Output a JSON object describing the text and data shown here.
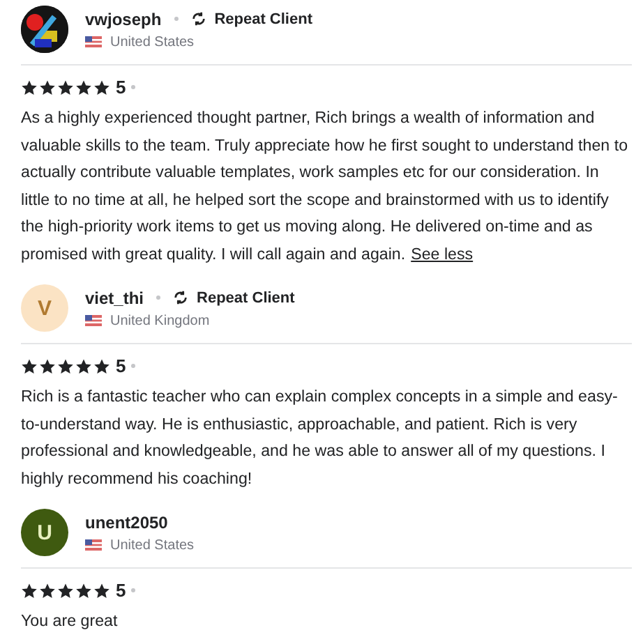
{
  "reviews": [
    {
      "name": "vwjoseph",
      "repeat_client": "Repeat Client",
      "country": "United States",
      "stars": 5,
      "rating": "5",
      "text": "As a highly experienced thought partner, Rich brings a wealth of information and valuable skills to the team. Truly appreciate how he first sought to understand then to actually contribute valuable templates, work samples etc for our consideration. In little to no time at all, he helped sort the scope and brainstormed with us to identify the high-priority work items to get us moving along. He delivered on-time and as promised with great quality. I will call again and again.",
      "toggle": "See less"
    },
    {
      "avatar": {
        "kind": "letter",
        "letter": "V",
        "color": "#fbe3c4"
      },
      "name": "viet_thi",
      "repeat_client": "Repeat Client",
      "country": "United Kingdom",
      "stars": 5,
      "rating": "5",
      "text": "Rich is a fantastic teacher who can explain complex concepts in a simple and easy-to-understand way. He is enthusiastic, approachable, and patient. Rich is very professional and knowledgeable, and he was able to answer all of my questions. I highly recommend his coaching!"
    },
    {
      "avatar": {
        "kind": "letter",
        "letter": "U",
        "color": "#3f5a10"
      },
      "name": "unent2050",
      "country": "United States",
      "stars": 5,
      "rating": "5",
      "text": "You are great"
    }
  ]
}
